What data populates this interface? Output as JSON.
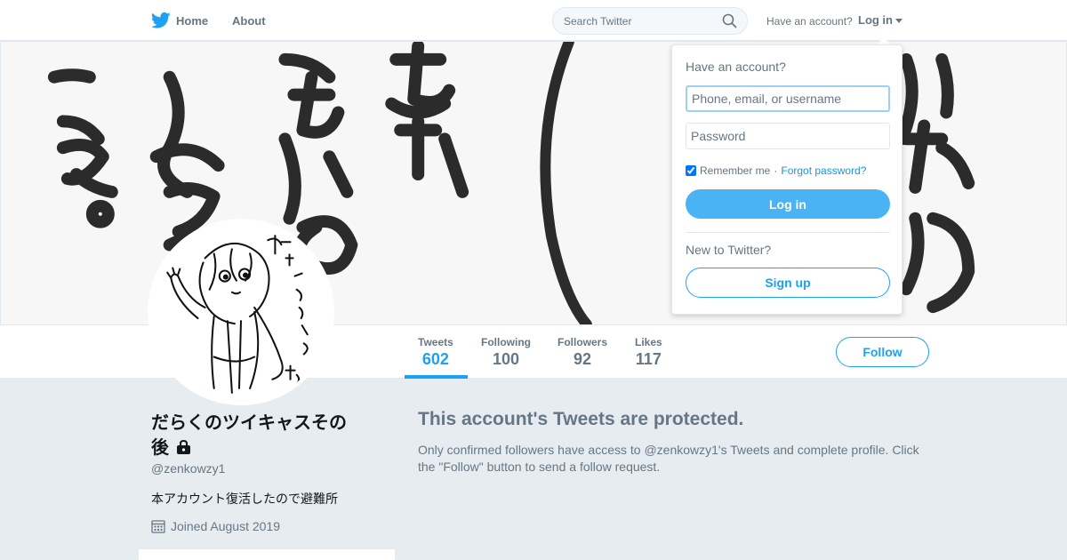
{
  "nav": {
    "home_label": "Home",
    "about_label": "About",
    "search_placeholder": "Search Twitter",
    "have_account": "Have an account?",
    "login_label": "Log in"
  },
  "profile_nav": {
    "stats": [
      {
        "label": "Tweets",
        "value": "602"
      },
      {
        "label": "Following",
        "value": "100"
      },
      {
        "label": "Followers",
        "value": "92"
      },
      {
        "label": "Likes",
        "value": "117"
      }
    ],
    "follow_label": "Follow"
  },
  "profile": {
    "name_line1": "だらくのツイキャスその",
    "name_line2": "後",
    "screen_name": "@zenkowzy1",
    "bio": "本アカウント復活したので避難所",
    "joined": "Joined August 2019"
  },
  "protected": {
    "title": "This account's Tweets are protected.",
    "text": "Only confirmed followers have access to @zenkowzy1's Tweets and complete profile. Click the \"Follow\" button to send a follow request."
  },
  "login_dropdown": {
    "heading": "Have an account?",
    "username_placeholder": "Phone, email, or username",
    "password_placeholder": "Password",
    "remember_label": "Remember me",
    "separator": "·",
    "forgot_label": "Forgot password?",
    "login_button": "Log in",
    "new_label": "New to Twitter?",
    "signup_button": "Sign up"
  },
  "colors": {
    "accent": "#1da1f2",
    "background": "#e6ecf0"
  },
  "icons": [
    "twitter-bird-icon",
    "search-icon",
    "caret-down-icon",
    "lock-icon",
    "calendar-icon"
  ]
}
